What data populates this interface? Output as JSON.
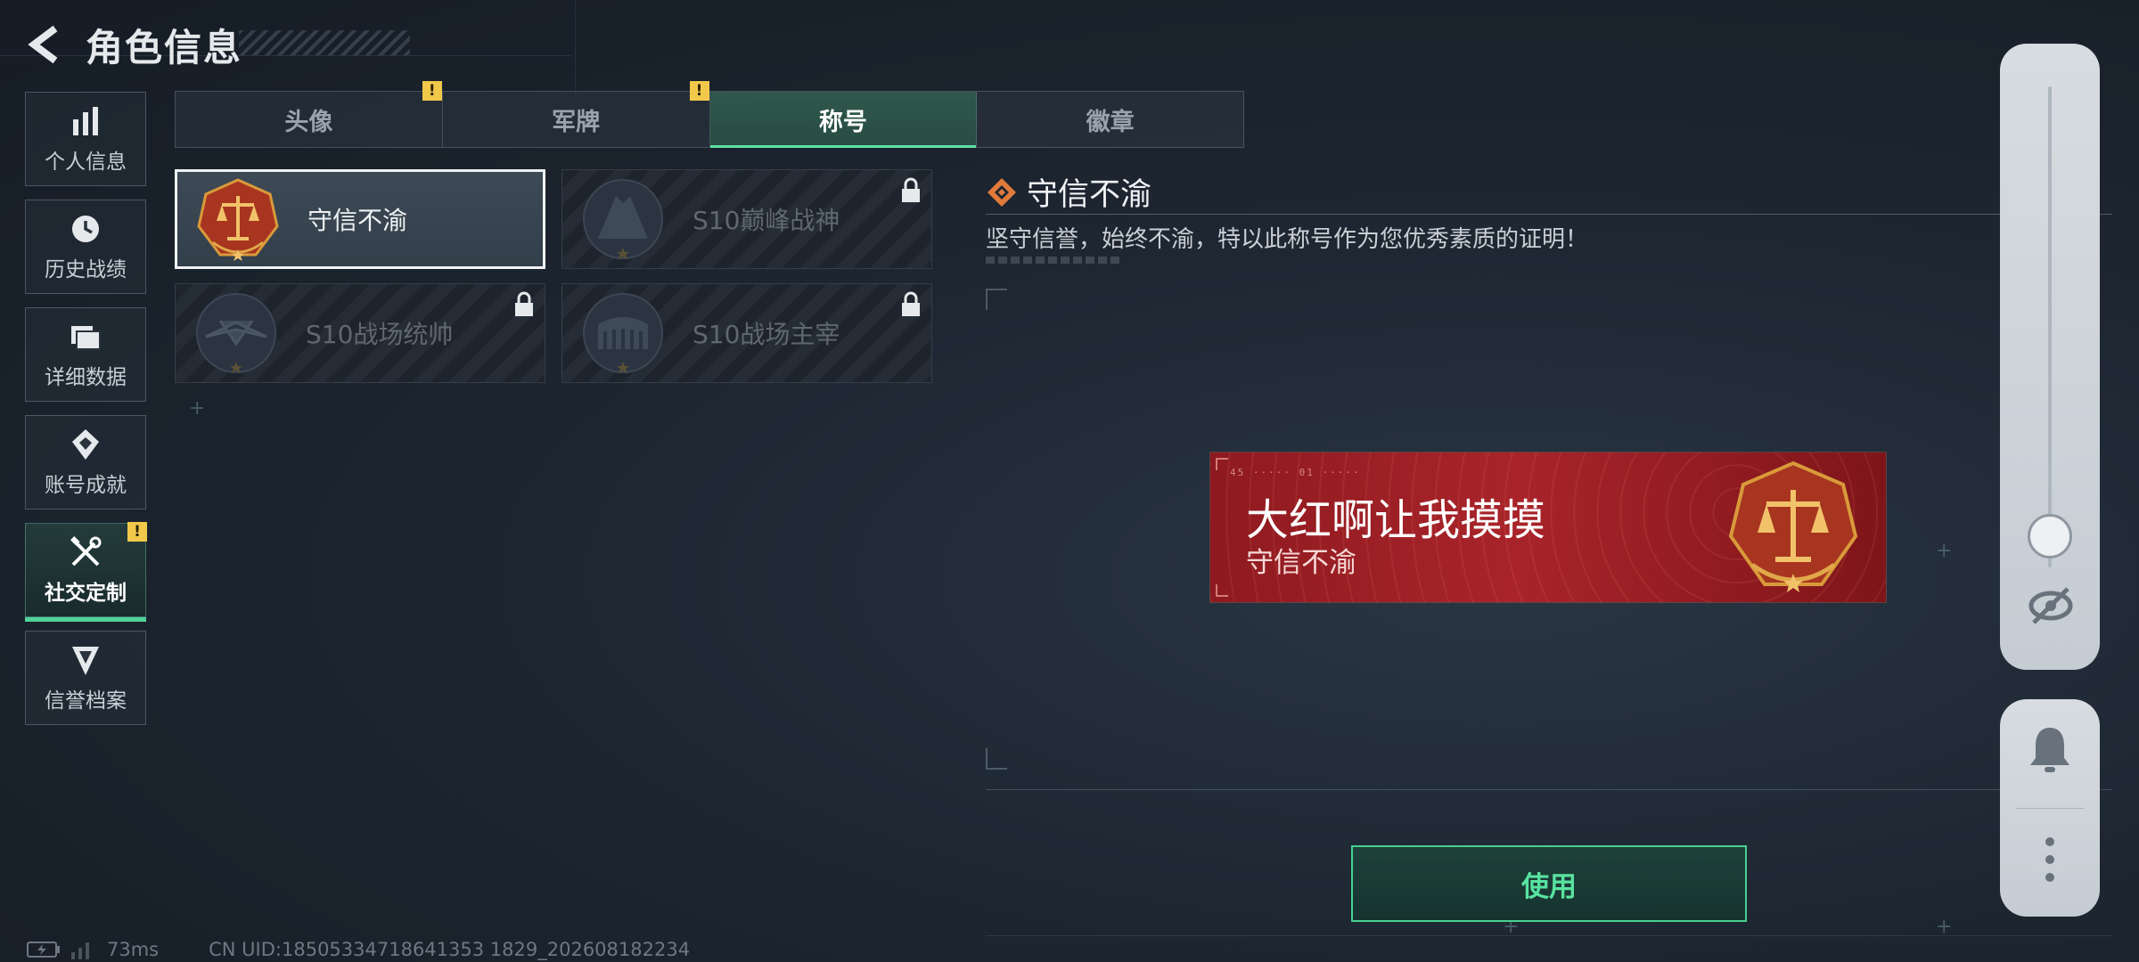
{
  "header": {
    "title": "角色信息"
  },
  "nav": {
    "items": [
      {
        "label": "个人信息",
        "icon": "bar-chart-icon"
      },
      {
        "label": "历史战绩",
        "icon": "clock-icon"
      },
      {
        "label": "详细数据",
        "icon": "folder-icon"
      },
      {
        "label": "账号成就",
        "icon": "achievement-icon"
      },
      {
        "label": "社交定制",
        "icon": "tools-icon",
        "active": true,
        "warning": "!"
      },
      {
        "label": "信誉档案",
        "icon": "credit-shield-icon"
      }
    ]
  },
  "tabs": [
    {
      "label": "头像",
      "warning": "!"
    },
    {
      "label": "军牌",
      "warning": "!"
    },
    {
      "label": "称号",
      "active": true
    },
    {
      "label": "徽章"
    }
  ],
  "titles": [
    {
      "name": "守信不渝",
      "locked": false,
      "selected": true
    },
    {
      "name": "S10巅峰战神",
      "locked": true
    },
    {
      "name": "S10战场统帅",
      "locked": true
    },
    {
      "name": "S10战场主宰",
      "locked": true
    }
  ],
  "detail": {
    "title": "守信不渝",
    "description": "坚守信誉，始终不渝，特以此称号作为您优秀素质的证明！"
  },
  "preview": {
    "player_name": "大红啊让我摸摸",
    "title": "守信不渝",
    "code_text": "45 ·····  01 ·····"
  },
  "actions": {
    "use_label": "使用"
  },
  "footer": {
    "ping": "73ms",
    "uid": "CN UID:18505334718641353 1829_202608182234"
  },
  "colors": {
    "accent": "#4fd39a",
    "warning": "#f2c84b",
    "banner_red": "#a8242a"
  }
}
